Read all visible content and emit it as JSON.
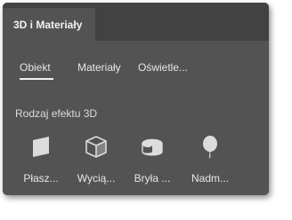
{
  "panel": {
    "title": "3D i Materiały"
  },
  "subtabs": [
    {
      "label": "Obiekt",
      "selected": true
    },
    {
      "label": "Materiały",
      "selected": false
    },
    {
      "label": "Oświetle...",
      "selected": false
    }
  ],
  "effects": {
    "heading": "Rodzaj efektu 3D",
    "items": [
      {
        "label": "Płasz...",
        "icon": "plane-icon"
      },
      {
        "label": "Wycią...",
        "icon": "extrude-cube-icon"
      },
      {
        "label": "Bryła ...",
        "icon": "revolve-icon"
      },
      {
        "label": "Nadm...",
        "icon": "inflate-balloon-icon"
      }
    ]
  },
  "colors": {
    "panel_bg": "#535353",
    "tabbar_bg": "#424242",
    "text": "#e6e6e6",
    "icon_fill": "#dcdcdc"
  }
}
